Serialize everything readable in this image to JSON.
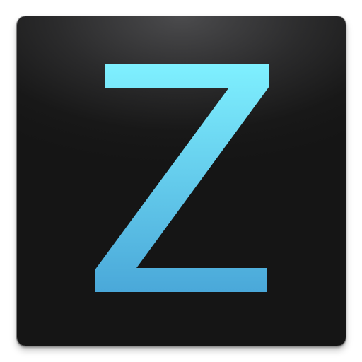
{
  "icon": {
    "glyph": "Z",
    "glyph_icon": "letter-z-icon",
    "colors": {
      "glyph_top": "#7ff0ff",
      "glyph_bottom": "#4aa8d9",
      "background_top": "#4b4b4d",
      "background_bottom": "#151515"
    }
  }
}
